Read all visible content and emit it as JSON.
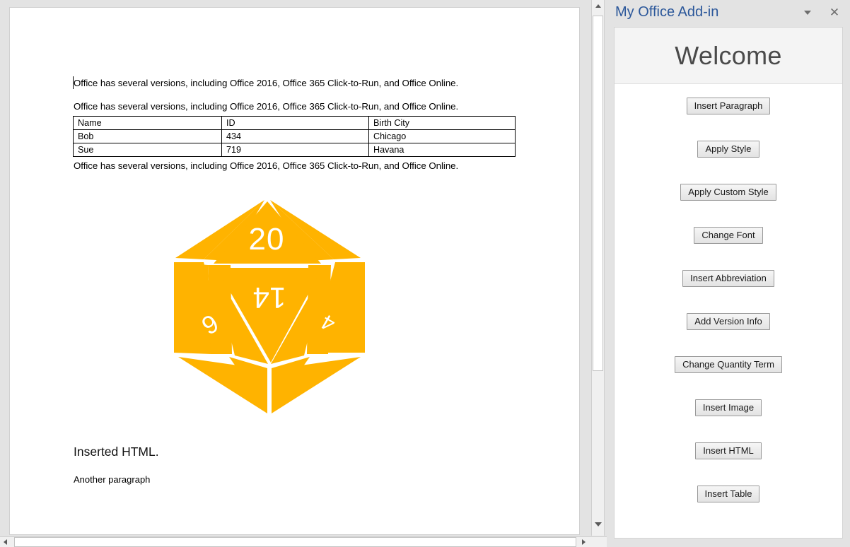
{
  "document": {
    "paragraph_1": "Office has several versions, including Office 2016, Office 365 Click-to-Run, and Office Online.",
    "paragraph_2": "Office has several versions, including Office 2016, Office 365 Click-to-Run, and Office Online.",
    "paragraph_3": "Office has several versions, including Office 2016, Office 365 Click-to-Run, and Office Online.",
    "table": {
      "headers": [
        "Name",
        "ID",
        "Birth City"
      ],
      "rows": [
        [
          "Bob",
          "434",
          "Chicago"
        ],
        [
          "Sue",
          "719",
          "Havana"
        ]
      ]
    },
    "image": {
      "name": "d20-die-icon",
      "color": "#FFB300",
      "face_numbers": [
        "20",
        "14",
        "6",
        "4"
      ]
    },
    "inserted_html_heading": "Inserted HTML.",
    "another_paragraph": "Another paragraph"
  },
  "scrollbars": {
    "vertical": {
      "up_icon": "triangle-up-icon",
      "down_icon": "triangle-down-icon"
    },
    "horizontal": {
      "left_icon": "triangle-left-icon",
      "right_icon": "triangle-right-icon"
    }
  },
  "task_pane": {
    "title": "My Office Add-in",
    "title_color": "#2B579A",
    "menu_icon": "chevron-down-icon",
    "close_icon": "close-icon",
    "close_glyph": "✕",
    "banner_heading": "Welcome",
    "buttons": [
      {
        "label": "Insert Paragraph"
      },
      {
        "label": "Apply Style"
      },
      {
        "label": "Apply Custom Style"
      },
      {
        "label": "Change Font"
      },
      {
        "label": "Insert Abbreviation"
      },
      {
        "label": "Add Version Info"
      },
      {
        "label": "Change Quantity Term"
      },
      {
        "label": "Insert Image"
      },
      {
        "label": "Insert HTML"
      },
      {
        "label": "Insert Table"
      }
    ]
  }
}
